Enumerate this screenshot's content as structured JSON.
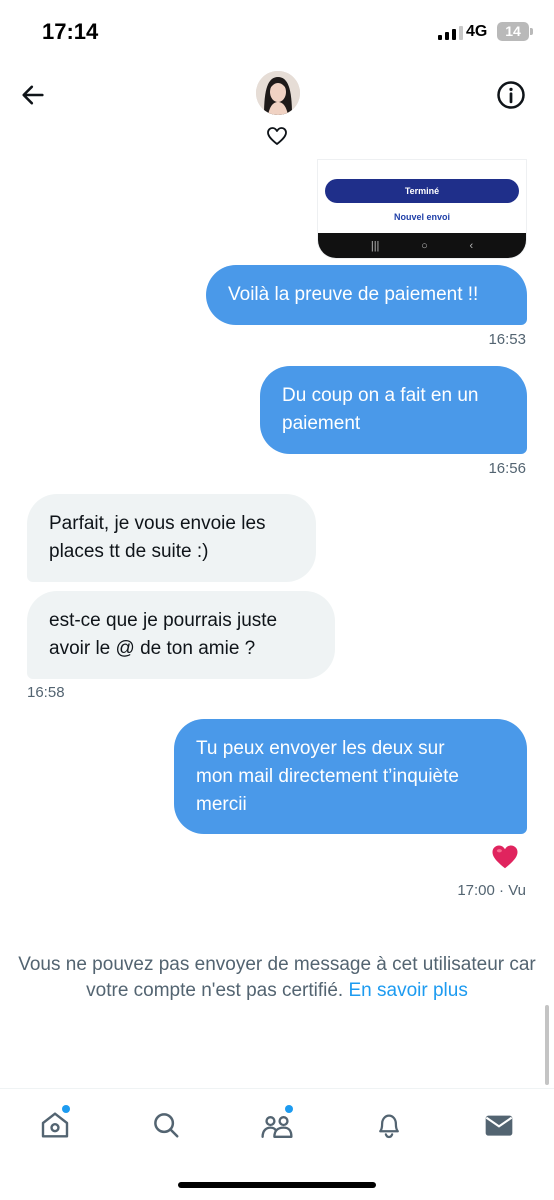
{
  "status_bar": {
    "time": "17:14",
    "network": "4G",
    "battery": "14"
  },
  "header": {
    "back_icon": "arrow-left-icon",
    "avatar_icon": "user-avatar",
    "heart_icon": "heart-outline-icon",
    "info_icon": "info-circle-icon"
  },
  "shared_image": {
    "button_label": "Terminé",
    "link_label": "Nouvel envoi",
    "nav_recent": "|||",
    "nav_home": "○",
    "nav_back": "‹"
  },
  "messages": [
    {
      "direction": "out",
      "text": "Voilà la preuve de paiement !!",
      "time": "16:53"
    },
    {
      "direction": "out",
      "text": "Du coup on a fait en un\npaiement",
      "time": "16:56"
    },
    {
      "direction": "in",
      "text": "Parfait, je vous envoie les\nplaces tt de suite :)"
    },
    {
      "direction": "in",
      "text": "est-ce que je pourrais juste\navoir le @ de ton amie ?",
      "time": "16:58"
    },
    {
      "direction": "out",
      "text": "Tu peux envoyer les deux sur\nmon mail directement t’inquiète\nmercii",
      "time": "17:00 · Vu",
      "reaction": "❤️"
    }
  ],
  "notice": {
    "text": "Vous ne pouvez pas envoyer de message à cet utilisateur car votre compte n'est pas certifié.",
    "link": "En savoir plus"
  },
  "tabbar": {
    "items": [
      {
        "name": "home",
        "icon": "home-icon",
        "badge": true
      },
      {
        "name": "search",
        "icon": "search-icon",
        "badge": false
      },
      {
        "name": "communities",
        "icon": "people-icon",
        "badge": true
      },
      {
        "name": "notifications",
        "icon": "bell-icon",
        "badge": false
      },
      {
        "name": "messages",
        "icon": "mail-icon",
        "badge": false
      }
    ]
  },
  "colors": {
    "outgoing_bubble": "#4a99e9",
    "incoming_bubble": "#eff3f4",
    "accent": "#1d9bf0",
    "secondary_text": "#536471",
    "reaction_heart": "#e0245e"
  }
}
